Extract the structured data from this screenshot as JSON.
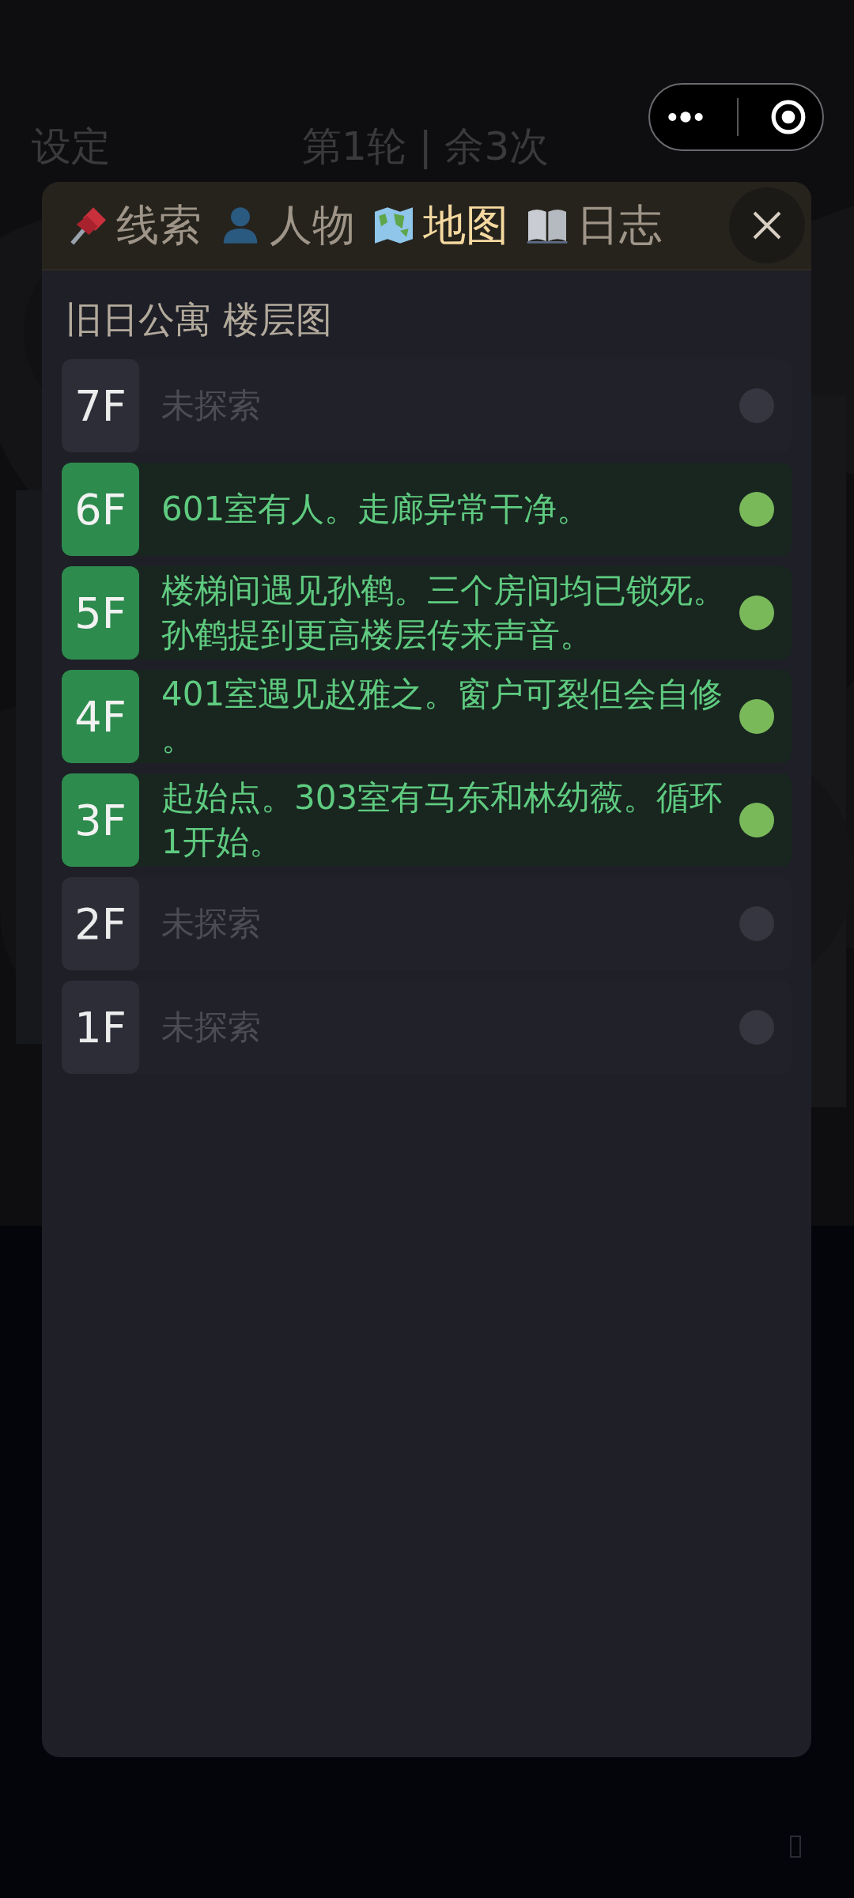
{
  "header": {
    "left": "设定",
    "center": "第1轮 | 余3次"
  },
  "tabs": [
    {
      "label": "线索",
      "selected": false
    },
    {
      "label": "人物",
      "selected": false
    },
    {
      "label": "地图",
      "selected": true
    },
    {
      "label": "日志",
      "selected": false
    }
  ],
  "map_title": "旧日公寓  楼层图",
  "floors": [
    {
      "label": "7F",
      "note": "未探索",
      "explored": false
    },
    {
      "label": "6F",
      "note": "601室有人。走廊异常干净。",
      "explored": true
    },
    {
      "label": "5F",
      "note": "楼梯间遇见孙鹤。三个房间均已锁死。孙鹤提到更高楼层传来声音。",
      "explored": true
    },
    {
      "label": "4F",
      "note": "401室遇见赵雅之。窗户可裂但会自修。",
      "explored": true
    },
    {
      "label": "3F",
      "note": "起始点。303室有马东和林幼薇。循环1开始。",
      "explored": true
    },
    {
      "label": "2F",
      "note": "未探索",
      "explored": false
    },
    {
      "label": "1F",
      "note": "未探索",
      "explored": false
    }
  ]
}
